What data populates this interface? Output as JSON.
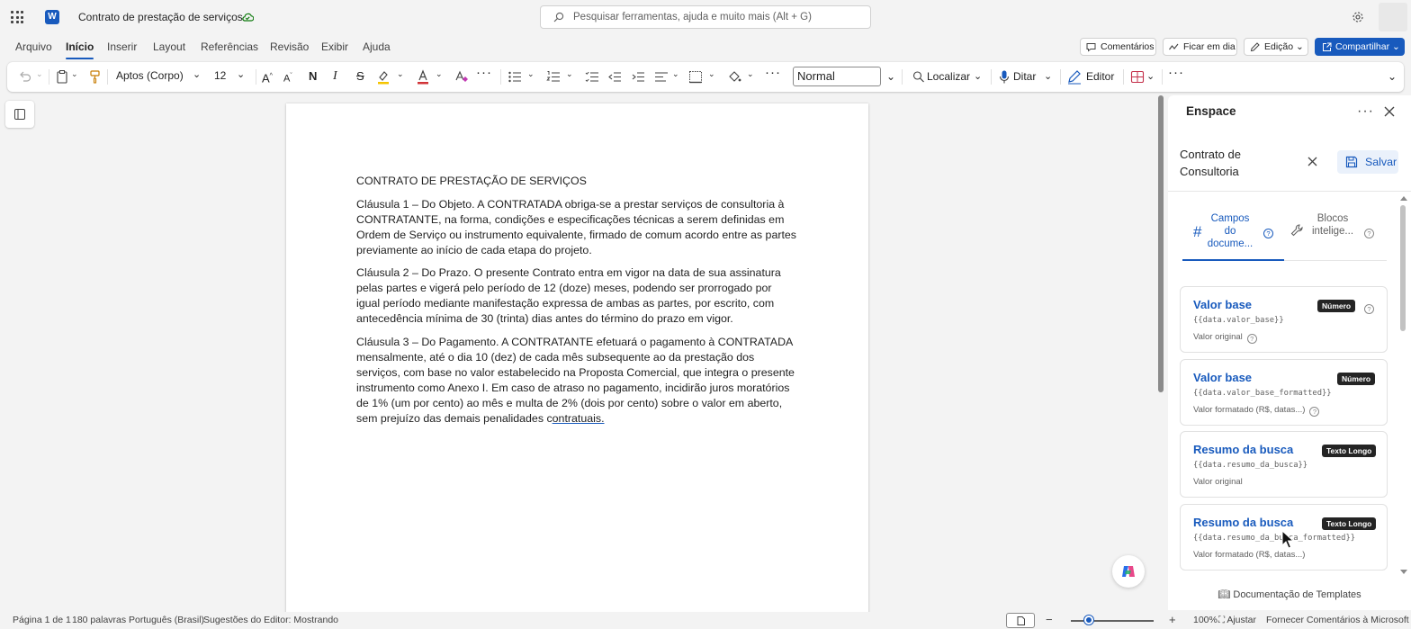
{
  "titlebar": {
    "app_logo": "W",
    "doc_title": "Contrato de prestação de serviços",
    "search_placeholder": "Pesquisar ferramentas, ajuda e muito mais (Alt + G)"
  },
  "menu": {
    "tabs": [
      "Arquivo",
      "Início",
      "Inserir",
      "Layout",
      "Referências",
      "Revisão",
      "Exibir",
      "Ajuda"
    ],
    "active_tab": "Início",
    "comments": "Comentários",
    "catch_up": "Ficar em dia",
    "editing": "Edição",
    "share": "Compartilhar"
  },
  "ribbon": {
    "font_name": "Aptos (Corpo)",
    "font_size": "12",
    "style": "Normal",
    "find": "Localizar",
    "dictate": "Ditar",
    "editor": "Editor"
  },
  "document": {
    "heading": "CONTRATO DE PRESTAÇÃO DE SERVIÇOS",
    "p1": "Cláusula 1 – Do Objeto. A CONTRATADA obriga-se a prestar serviços de consultoria à CONTRATANTE, na forma, condições e especificações técnicas a serem definidas em Ordem de Serviço ou instrumento equivalente, firmado de comum acordo entre as partes previamente ao início de cada etapa do projeto.",
    "p2": "Cláusula 2 – Do Prazo. O presente Contrato entra em vigor na data de sua assinatura pelas partes e vigerá pelo período de 12 (doze) meses, podendo ser prorrogado por igual período mediante manifestação expressa de ambas as partes, por escrito, com antecedência mínima de 30 (trinta) dias antes do término do prazo em vigor.",
    "p3_pre": "Cláusula 3 – Do Pagamento. A CONTRATANTE efetuará o pagamento à CONTRATADA mensalmente, até o dia 10 (dez) de cada mês subsequente ao da prestação dos serviços, com base no valor estabelecido na Proposta Comercial, que integra o presente instrumento como Anexo I. Em caso de atraso no pagamento, incidirão juros moratórios de 1% (um por cento) ao mês e multa de 2% (dois por cento) sobre o valor em aberto, sem prejuízo das demais penalidades c",
    "p3_link": "ontratuais."
  },
  "panel": {
    "title": "Enspace",
    "template_title": "Contrato de Consultoria",
    "save": "Salvar",
    "tab_fields": "Campos do docume...",
    "tab_blocks": "Blocos intelige...",
    "fields": [
      {
        "title": "Valor base",
        "badge": "Número",
        "code": "{{data.valor_base}}",
        "sub": "Valor original",
        "title_help": true,
        "sub_help": true
      },
      {
        "title": "Valor base",
        "badge": "Número",
        "code": "{{data.valor_base_formatted}}",
        "sub": "Valor formatado (R$, datas...)",
        "title_help": false,
        "sub_help": true
      },
      {
        "title": "Resumo da busca",
        "badge": "Texto Longo",
        "code": "{{data.resumo_da_busca}}",
        "sub": "Valor original",
        "title_help": false,
        "sub_help": false
      },
      {
        "title": "Resumo da busca",
        "badge": "Texto Longo",
        "code": "{{data.resumo_da_busca_formatted}}",
        "sub": "Valor formatado (R$, datas...)",
        "title_help": false,
        "sub_help": false
      }
    ],
    "docs_link": "Documentação de Templates"
  },
  "status": {
    "page": "Página 1 de 1",
    "words": "180 palavras",
    "language": "Português (Brasil)",
    "suggestions": "Sugestões do Editor: Mostrando",
    "zoom": "100%",
    "fit": "Ajustar",
    "feedback": "Fornecer Comentários à Microsoft"
  },
  "colors": {
    "accent": "#185abd",
    "badge_bg": "#242424",
    "saved_green": "#0e7a0d"
  }
}
